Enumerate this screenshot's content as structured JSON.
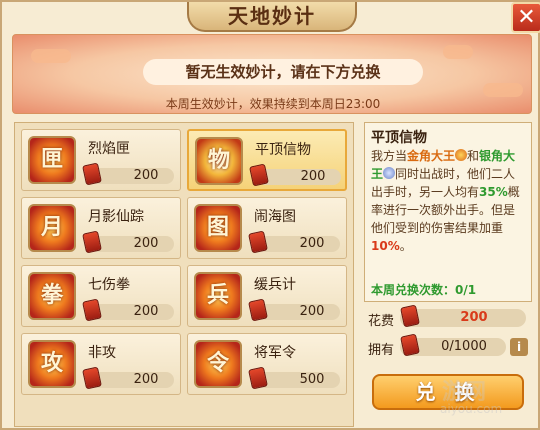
{
  "window": {
    "title": "天地妙计",
    "close_label": "✕"
  },
  "banner": {
    "message": "暂无生效妙计，请在下方兑换",
    "sub": "本周生效妙计，效果持续到本周日23:00"
  },
  "items": [
    {
      "name": "烈焰匣",
      "cost": "200",
      "glyph": "匣",
      "selected": false
    },
    {
      "name": "平顶信物",
      "cost": "200",
      "glyph": "物",
      "selected": true
    },
    {
      "name": "月影仙踪",
      "cost": "200",
      "glyph": "月",
      "selected": false
    },
    {
      "name": "闹海图",
      "cost": "200",
      "glyph": "图",
      "selected": false
    },
    {
      "name": "七伤拳",
      "cost": "200",
      "glyph": "拳",
      "selected": false
    },
    {
      "name": "缓兵计",
      "cost": "200",
      "glyph": "兵",
      "selected": false
    },
    {
      "name": "非攻",
      "cost": "200",
      "glyph": "攻",
      "selected": false
    },
    {
      "name": "将军令",
      "cost": "500",
      "glyph": "令",
      "selected": false
    }
  ],
  "detail": {
    "title": "平顶信物",
    "desc": {
      "p1": "我方当",
      "king1": "金角大王",
      "p2": "和",
      "king2": "银角大王",
      "p3": "同时出战时，他们二人出手时，另一人均有",
      "pct": "35%",
      "p4": "概率进行一次额外出手。但是他们受到的伤害结果加重",
      "pct2": "10%",
      "p5": "。"
    },
    "weekly": "本周兑换次数：0/1"
  },
  "cost_row": {
    "label": "花费",
    "value": "200",
    "color": "#d93a1a"
  },
  "own_row": {
    "label": "拥有",
    "value": "0/1000",
    "info": "i"
  },
  "exchange_button": "兑 换",
  "watermark": {
    "main": "游网",
    "sub": "aiyou.com"
  }
}
